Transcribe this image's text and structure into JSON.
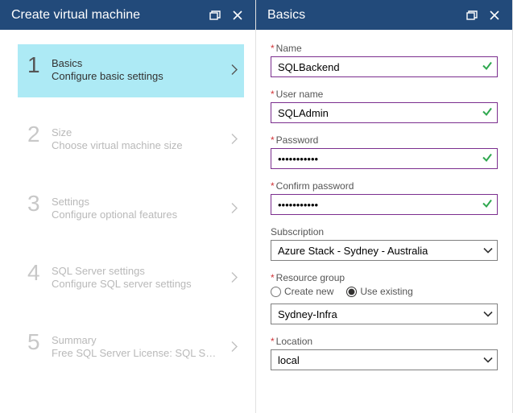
{
  "leftPane": {
    "title": "Create virtual machine",
    "steps": [
      {
        "num": "1",
        "title": "Basics",
        "sub": "Configure basic settings"
      },
      {
        "num": "2",
        "title": "Size",
        "sub": "Choose virtual machine size"
      },
      {
        "num": "3",
        "title": "Settings",
        "sub": "Configure optional features"
      },
      {
        "num": "4",
        "title": "SQL Server settings",
        "sub": "Configure SQL server settings"
      },
      {
        "num": "5",
        "title": "Summary",
        "sub": "Free SQL Server License: SQL S…"
      }
    ]
  },
  "rightPane": {
    "title": "Basics",
    "name": {
      "label": "Name",
      "value": "SQLBackend"
    },
    "username": {
      "label": "User name",
      "value": "SQLAdmin"
    },
    "password": {
      "label": "Password",
      "value": "•••••••••••"
    },
    "confirm": {
      "label": "Confirm password",
      "value": "•••••••••••"
    },
    "subscription": {
      "label": "Subscription",
      "selected": "Azure Stack - Sydney - Australia"
    },
    "resourceGroup": {
      "label": "Resource group",
      "options": {
        "createNew": "Create new",
        "useExisting": "Use existing"
      },
      "mode": "useExisting",
      "selected": "Sydney-Infra"
    },
    "location": {
      "label": "Location",
      "selected": "local"
    }
  }
}
